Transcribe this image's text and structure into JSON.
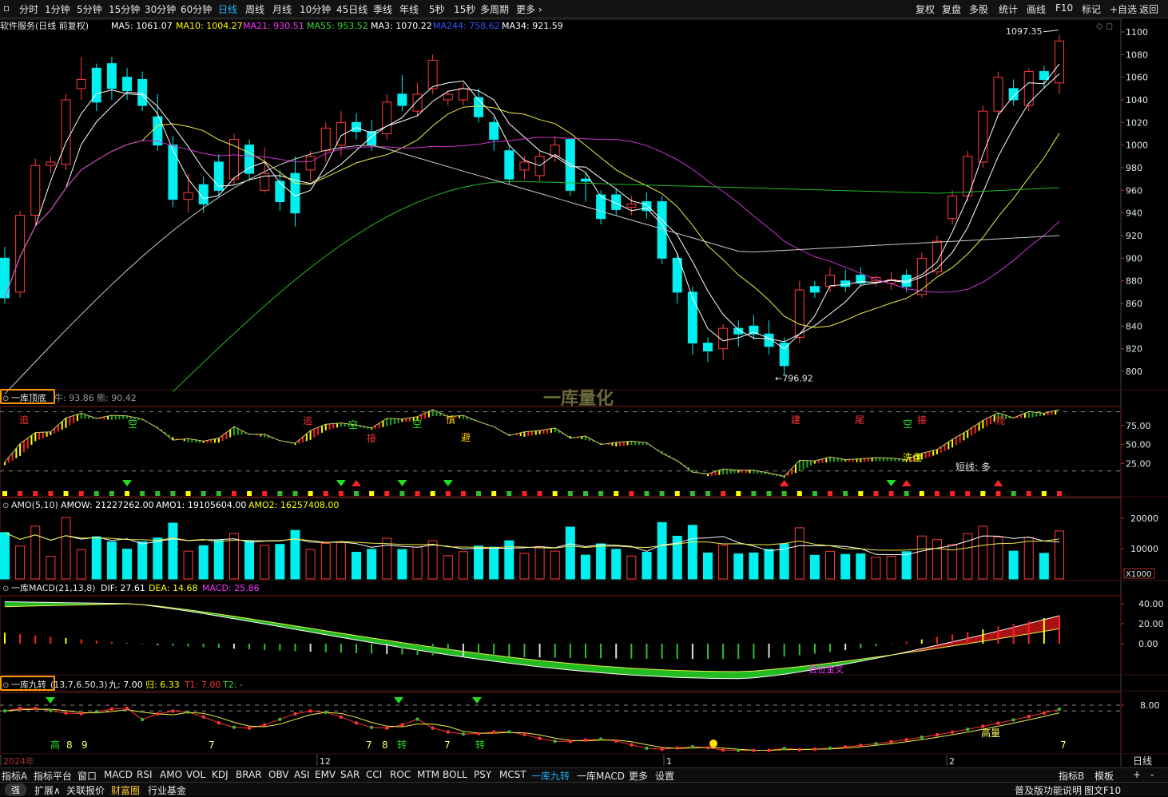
{
  "toolbar": {
    "tabs": [
      "分时",
      "1分钟",
      "5分钟",
      "15分钟",
      "30分钟",
      "60分钟",
      "日线",
      "周线",
      "月线",
      "10分钟",
      "45日线",
      "季线",
      "年线",
      "5秒",
      "15秒",
      "多周期",
      "更多"
    ],
    "active": "日线",
    "right": [
      "复权",
      "复盘",
      "多股",
      "统计",
      "画线",
      "F10",
      "标记",
      "+自选",
      "返回"
    ]
  },
  "main_header": {
    "title": "软件服务(日线 前复权)",
    "ma": [
      {
        "label": "MA5: 1061.07",
        "color": "#ffffff"
      },
      {
        "label": "MA10: 1004.27",
        "color": "#ffff00"
      },
      {
        "label": "MA21: 930.51",
        "color": "#ff33ff"
      },
      {
        "label": "MA55: 953.52",
        "color": "#33dd33"
      },
      {
        "label": "MA3: 1070.22",
        "color": "#ffffff"
      },
      {
        "label": "MA244: 758.62",
        "color": "#3355ff"
      },
      {
        "label": "MA34: 921.59",
        "color": "#ffffff"
      }
    ]
  },
  "price_labels": {
    "high": "1097.35",
    "low": "796.92"
  },
  "watermark": "一库量化",
  "panels": {
    "topbottom": {
      "name": "一库顶底",
      "vals": [
        "牛: 93.86",
        "熊: 90.42"
      ],
      "annotations": [
        "追",
        "空",
        "追",
        "空",
        "接",
        "空",
        "慎",
        "避",
        "建",
        "尾",
        "空",
        "接",
        "洗盘",
        "短线: 多",
        "观"
      ]
    },
    "amo": {
      "name": "AMO(5,10)",
      "vals": [
        {
          "label": "AMOW: 21227262.00",
          "color": "#ffffff"
        },
        {
          "label": "AMO1: 19105604.00",
          "color": "#ffffff"
        },
        {
          "label": "AMO2: 16257408.00",
          "color": "#ffff00"
        }
      ],
      "unit": "X1000"
    },
    "macd": {
      "name": "一库MACD(21,13,8)",
      "vals": [
        {
          "label": "DIF: 27.61",
          "color": "#ffffff"
        },
        {
          "label": "DEA: 14.68",
          "color": "#ffff00"
        },
        {
          "label": "MACD: 25.86",
          "color": "#ff33ff"
        }
      ],
      "annotation": "低位金叉"
    },
    "nine": {
      "name": "一库九转",
      "params": "(13,7,6.50,3)",
      "vals": [
        {
          "label": "九: 7.00",
          "color": "#ffffff"
        },
        {
          "label": "归: 6.33",
          "color": "#ffff00"
        },
        {
          "label": "T1: 7.00",
          "color": "#ff3333"
        },
        {
          "label": "T2: -",
          "color": "#33dd33"
        }
      ],
      "annotations": [
        "高",
        "8",
        "9",
        "7",
        "7",
        "8",
        "转",
        "7",
        "转",
        "高量",
        "7"
      ]
    }
  },
  "date_axis": {
    "labels": [
      "2024年",
      "12",
      "1",
      "2"
    ],
    "right": "日线"
  },
  "bottom_row1": {
    "tabs": [
      "指标A",
      "指标平台",
      "窗口",
      "MACD",
      "RSI",
      "AMO",
      "VOL",
      "KDJ",
      "BRAR",
      "OBV",
      "ASI",
      "EMV",
      "SAR",
      "CCI",
      "ROC",
      "MTM",
      "BOLL",
      "PSY",
      "MCST",
      "一库九转",
      "一库MACD",
      "更多",
      "设置"
    ],
    "active": "一库九转",
    "right": [
      "指标B",
      "模板",
      "+",
      "-"
    ]
  },
  "bottom_row2": {
    "items": [
      "强",
      "扩展∧",
      "关联报价",
      "财富圈",
      "行业基金"
    ],
    "right": [
      "普及版功能说明",
      "图文F10"
    ]
  },
  "chart_data": {
    "type": "candlestick",
    "ylim": [
      780,
      1110
    ],
    "yticks": [
      1100,
      1080,
      1060,
      1040,
      1020,
      1000,
      980,
      960,
      940,
      920,
      900,
      880,
      860,
      840,
      820,
      800
    ],
    "candles": [
      [
        900,
        865,
        910,
        860
      ],
      [
        870,
        938,
        942,
        865
      ],
      [
        938,
        982,
        988,
        930
      ],
      [
        982,
        985,
        990,
        975
      ],
      [
        983,
        1040,
        1045,
        978
      ],
      [
        1050,
        1058,
        1078,
        1040
      ],
      [
        1068,
        1038,
        1072,
        1030
      ],
      [
        1072,
        1050,
        1078,
        1040
      ],
      [
        1060,
        1048,
        1068,
        1040
      ],
      [
        1058,
        1035,
        1065,
        1030
      ],
      [
        1025,
        1000,
        1045,
        995
      ],
      [
        1000,
        952,
        1008,
        945
      ],
      [
        952,
        958,
        975,
        940
      ],
      [
        965,
        948,
        972,
        940
      ],
      [
        985,
        960,
        992,
        955
      ],
      [
        970,
        1005,
        1010,
        965
      ],
      [
        1000,
        975,
        1005,
        970
      ],
      [
        960,
        975,
        998,
        958
      ],
      [
        968,
        950,
        978,
        942
      ],
      [
        975,
        940,
        990,
        928
      ],
      [
        978,
        990,
        995,
        968
      ],
      [
        995,
        1015,
        1020,
        985
      ],
      [
        1000,
        1020,
        1030,
        990
      ],
      [
        1020,
        1012,
        1028,
        1005
      ],
      [
        1012,
        1000,
        1022,
        995
      ],
      [
        1010,
        1038,
        1045,
        1005
      ],
      [
        1045,
        1035,
        1062,
        1030
      ],
      [
        1030,
        1045,
        1055,
        1025
      ],
      [
        1050,
        1075,
        1080,
        1045
      ],
      [
        1040,
        1045,
        1048,
        1035
      ],
      [
        1040,
        1050,
        1055,
        1035
      ],
      [
        1042,
        1025,
        1050,
        1020
      ],
      [
        1020,
        1005,
        1025,
        995
      ],
      [
        995,
        970,
        1000,
        965
      ],
      [
        978,
        985,
        990,
        970
      ],
      [
        973,
        990,
        995,
        968
      ],
      [
        990,
        1000,
        1008,
        985
      ],
      [
        1005,
        960,
        1005,
        955
      ],
      [
        970,
        968,
        975,
        950
      ],
      [
        956,
        935,
        960,
        930
      ],
      [
        956,
        943,
        962,
        938
      ],
      [
        945,
        948,
        955,
        938
      ],
      [
        950,
        942,
        958,
        935
      ],
      [
        950,
        900,
        955,
        895
      ],
      [
        900,
        870,
        905,
        860
      ],
      [
        870,
        825,
        875,
        815
      ],
      [
        825,
        818,
        830,
        808
      ],
      [
        820,
        838,
        842,
        810
      ],
      [
        838,
        833,
        845,
        822
      ],
      [
        840,
        833,
        850,
        828
      ],
      [
        833,
        822,
        845,
        815
      ],
      [
        825,
        805,
        830,
        796.92
      ],
      [
        830,
        872,
        880,
        825
      ],
      [
        875,
        870,
        880,
        865
      ],
      [
        875,
        885,
        892,
        870
      ],
      [
        880,
        875,
        890,
        870
      ],
      [
        885,
        878,
        892,
        875
      ],
      [
        880,
        883,
        885,
        875
      ],
      [
        878,
        881,
        888,
        872
      ],
      [
        885,
        875,
        890,
        870
      ],
      [
        868,
        900,
        905,
        865
      ],
      [
        888,
        915,
        920,
        885
      ],
      [
        935,
        955,
        960,
        930
      ],
      [
        955,
        990,
        995,
        950
      ],
      [
        985,
        1030,
        1035,
        980
      ],
      [
        1030,
        1060,
        1065,
        1025
      ],
      [
        1050,
        1040,
        1058,
        1035
      ],
      [
        1035,
        1065,
        1068,
        1030
      ],
      [
        1065,
        1058,
        1070,
        1050
      ],
      [
        1055,
        1092,
        1097.35,
        1045
      ]
    ]
  }
}
